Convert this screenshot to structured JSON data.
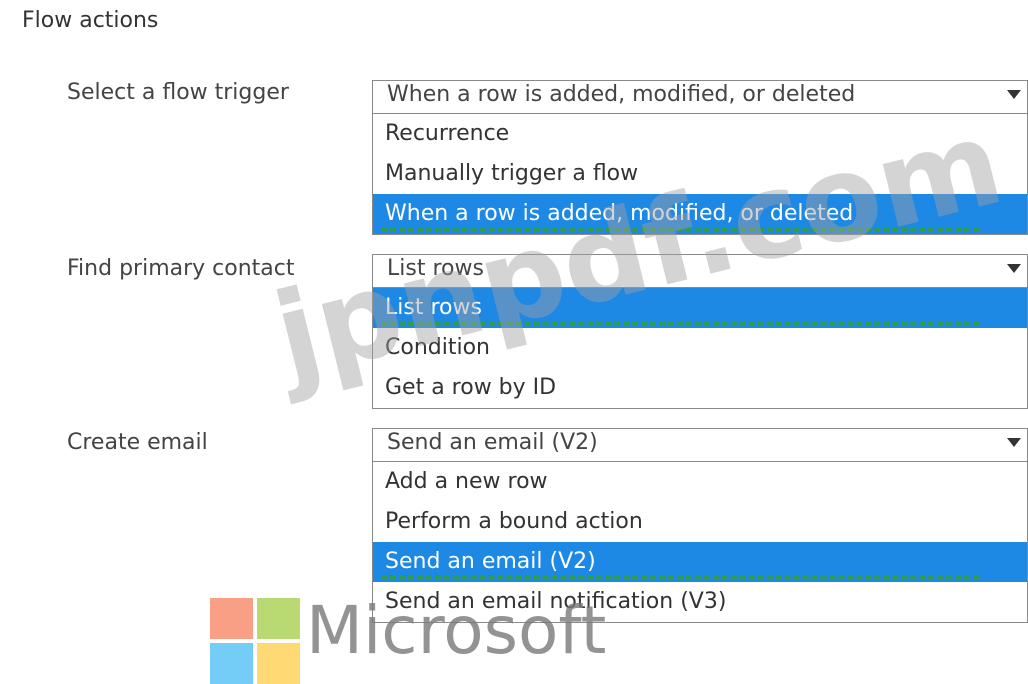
{
  "section_title": "Flow actions",
  "fields": [
    {
      "label": "Select a flow trigger",
      "selected_value": "When a row is added, modified, or deleted",
      "options": [
        "Recurrence",
        "Manually trigger a flow",
        "When a row is added, modified, or deleted"
      ],
      "highlighted_index": 2
    },
    {
      "label": "Find primary contact",
      "selected_value": "List rows",
      "options": [
        "List rows",
        "Condition",
        "Get a row by ID"
      ],
      "highlighted_index": 0
    },
    {
      "label": "Create email",
      "selected_value": "Send an email (V2)",
      "options": [
        "Add a new row",
        "Perform a bound action",
        "Send an email (V2)",
        "Send an email notification (V3)"
      ],
      "highlighted_index": 2
    }
  ],
  "watermark": "jpnpdf.com",
  "logo": {
    "text": "Microsoft",
    "colors": [
      "#f25022",
      "#7fba00",
      "#00a4ef",
      "#ffb900"
    ]
  },
  "icons": {
    "dropdown_arrow": "caret-down-icon"
  },
  "accent_color": "#1e88e5"
}
